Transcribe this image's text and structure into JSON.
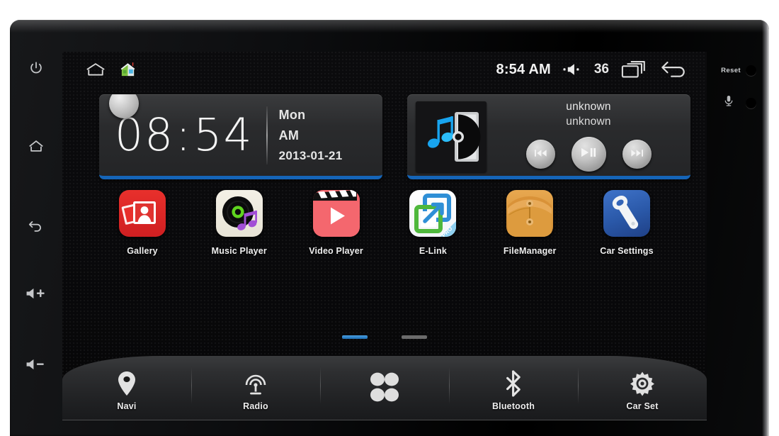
{
  "device": {
    "left_keys": [
      {
        "name": "power",
        "glyph": "power-icon"
      },
      {
        "name": "home",
        "glyph": "home-icon"
      },
      {
        "name": "back",
        "glyph": "back-icon"
      },
      {
        "name": "volume-up",
        "label": "+"
      },
      {
        "name": "volume-down",
        "label": "−"
      }
    ],
    "right_marks": [
      {
        "label": "Reset",
        "icon": ""
      },
      {
        "label": "",
        "icon": "microphone-icon"
      }
    ]
  },
  "statusbar": {
    "home_icon": "home-outline-icon",
    "house_icon": "house-color-icon",
    "time": "8:54 AM",
    "volume_icon": "volume-icon",
    "volume_value": "36",
    "recents_icon": "recent-apps-icon",
    "back_icon": "back-arrow-icon"
  },
  "clock_widget": {
    "hours": "08",
    "separator": ":",
    "minutes": "54",
    "weekday": "Mon",
    "meridiem": "AM",
    "date": "2013-01-21",
    "accent": "#1565b8"
  },
  "music_widget": {
    "album_art": "cd-music-note-art",
    "title": "unknown",
    "artist": "unknown",
    "prev_icon": "previous-track-icon",
    "play_icon": "play-pause-icon",
    "next_icon": "next-track-icon",
    "accent": "#1565b8"
  },
  "apps": [
    {
      "label": "Gallery",
      "icon": "gallery-icon",
      "color": "#e8302c"
    },
    {
      "label": "Music Player",
      "icon": "music-player-icon",
      "color": "#f3f0e6"
    },
    {
      "label": "Video Player",
      "icon": "video-player-icon",
      "color": "#f4676e"
    },
    {
      "label": "E-Link",
      "icon": "e-link-icon",
      "color": "#ffffff"
    },
    {
      "label": "FileManager",
      "icon": "file-manager-icon",
      "color": "#e8a850"
    },
    {
      "label": "Car Settings",
      "icon": "car-settings-icon",
      "color": "#3f73c9"
    }
  ],
  "page_indicator": {
    "pages": 2,
    "active": 0
  },
  "dock": [
    {
      "label": "Navi",
      "icon": "map-pin-icon"
    },
    {
      "label": "Radio",
      "icon": "radio-antenna-icon"
    },
    {
      "label": "",
      "icon": "apps-grid-icon"
    },
    {
      "label": "Bluetooth",
      "icon": "bluetooth-icon"
    },
    {
      "label": "Car Set",
      "icon": "gear-icon"
    }
  ]
}
